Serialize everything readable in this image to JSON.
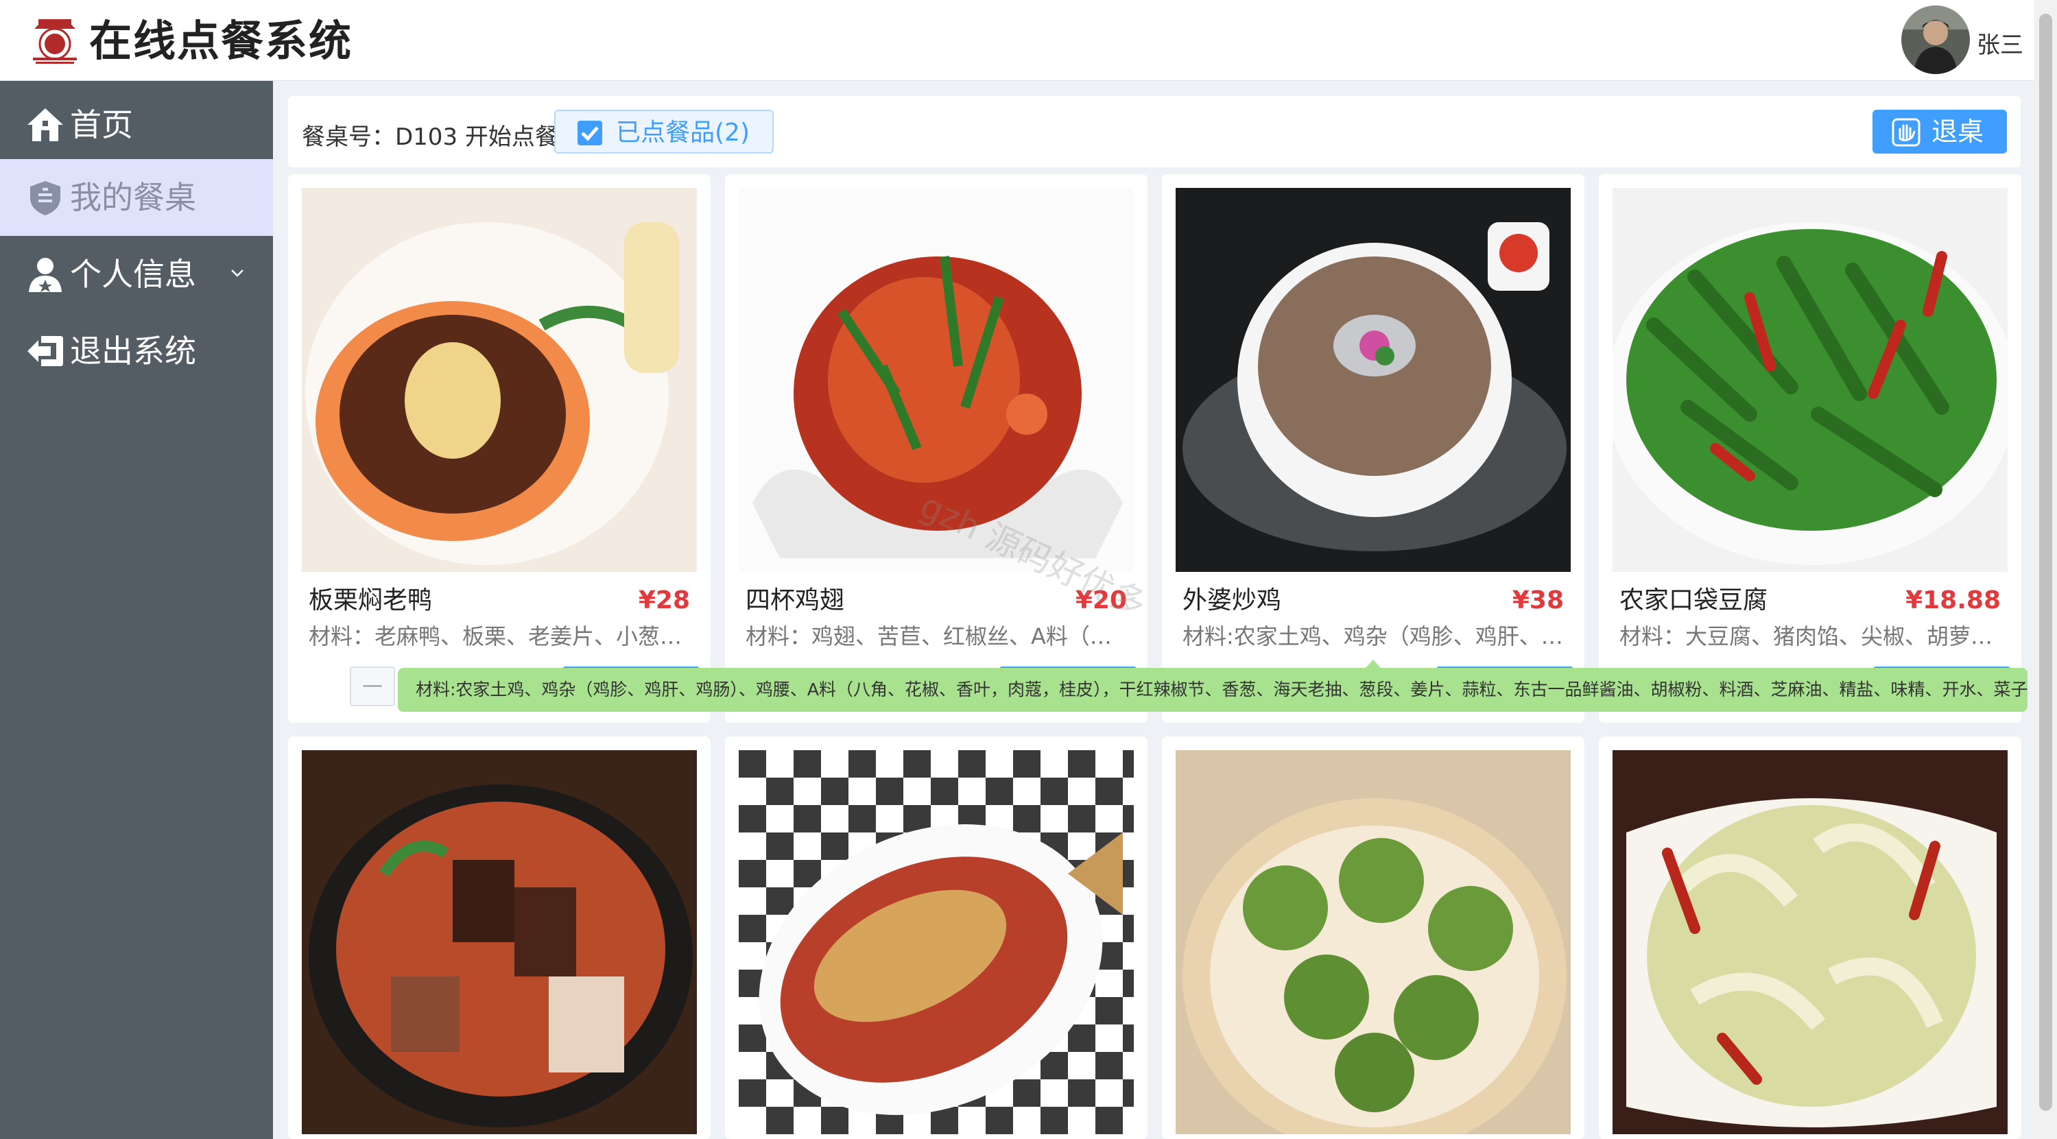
{
  "header": {
    "title": "在线点餐系统",
    "user_name": "张三"
  },
  "sidebar": {
    "items": [
      {
        "label": "首页",
        "icon": "home-icon",
        "active": false
      },
      {
        "label": "我的餐桌",
        "icon": "shield-icon",
        "active": true
      },
      {
        "label": "个人信息",
        "icon": "user-icon",
        "active": false,
        "has_submenu": true
      },
      {
        "label": "退出系统",
        "icon": "exit-icon",
        "active": false
      }
    ]
  },
  "toolbar": {
    "table_label": "餐桌号：D103 开始点餐",
    "ordered_label": "已点餐品(2)",
    "leave_label": "退桌"
  },
  "dishes": [
    {
      "name": "板栗焖老鸭",
      "price": "¥28",
      "desc": "材料：老麻鸭、板栗、老姜片、小葱…"
    },
    {
      "name": "四杯鸡翅",
      "price": "¥20",
      "desc": "材料：鸡翅、苦苣、红椒丝、A料（…"
    },
    {
      "name": "外婆炒鸡",
      "price": "¥38",
      "desc": "材料:农家土鸡、鸡杂（鸡胗、鸡肝、…"
    },
    {
      "name": "农家口袋豆腐",
      "price": "¥18.88",
      "desc": "材料：大豆腐、猪肉馅、尖椒、胡萝…"
    },
    {
      "name": "",
      "price": "",
      "desc": ""
    },
    {
      "name": "",
      "price": "",
      "desc": ""
    },
    {
      "name": "",
      "price": "",
      "desc": ""
    },
    {
      "name": "",
      "price": "",
      "desc": ""
    }
  ],
  "tooltip": "材料:农家土鸡、鸡杂（鸡胗、鸡肝、鸡肠）、鸡腰、A料（八角、花椒、香叶，肉蔻，桂皮），干红辣椒节、香葱、海天老抽、葱段、姜片、蒜粒、东古一品鲜酱油、胡椒粉、料酒、芝麻油、精盐、味精、开水、菜子油。",
  "stepper": {
    "minus": "—"
  },
  "watermark": "gzh 源码好优多",
  "colors": {
    "sidebar_bg": "#545c64",
    "primary": "#409eff",
    "price": "#e4393c",
    "tooltip_bg": "#a8e28f",
    "active_nav_bg": "#e0e2fb"
  }
}
